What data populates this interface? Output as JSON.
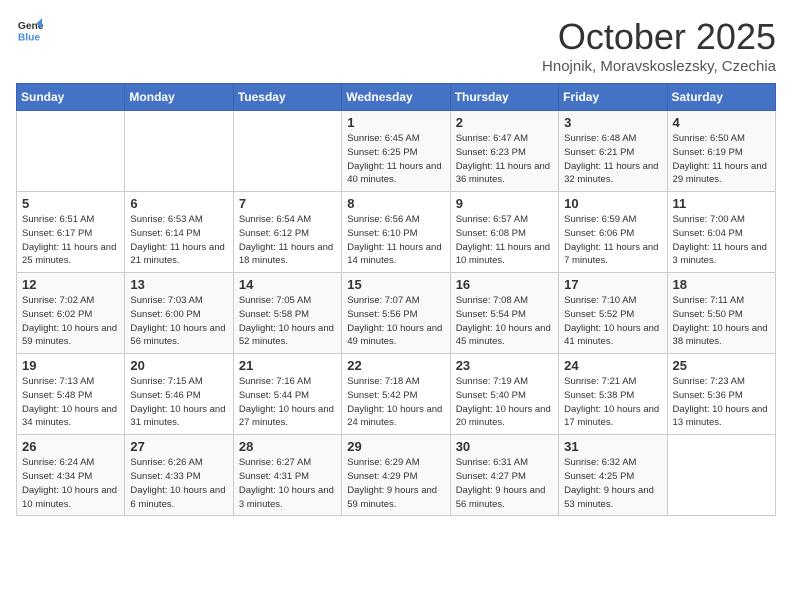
{
  "logo": {
    "line1": "General",
    "line2": "Blue"
  },
  "title": "October 2025",
  "location": "Hnojnik, Moravskoslezsky, Czechia",
  "weekdays": [
    "Sunday",
    "Monday",
    "Tuesday",
    "Wednesday",
    "Thursday",
    "Friday",
    "Saturday"
  ],
  "weeks": [
    [
      {
        "num": "",
        "info": ""
      },
      {
        "num": "",
        "info": ""
      },
      {
        "num": "",
        "info": ""
      },
      {
        "num": "1",
        "info": "Sunrise: 6:45 AM\nSunset: 6:25 PM\nDaylight: 11 hours\nand 40 minutes."
      },
      {
        "num": "2",
        "info": "Sunrise: 6:47 AM\nSunset: 6:23 PM\nDaylight: 11 hours\nand 36 minutes."
      },
      {
        "num": "3",
        "info": "Sunrise: 6:48 AM\nSunset: 6:21 PM\nDaylight: 11 hours\nand 32 minutes."
      },
      {
        "num": "4",
        "info": "Sunrise: 6:50 AM\nSunset: 6:19 PM\nDaylight: 11 hours\nand 29 minutes."
      }
    ],
    [
      {
        "num": "5",
        "info": "Sunrise: 6:51 AM\nSunset: 6:17 PM\nDaylight: 11 hours\nand 25 minutes."
      },
      {
        "num": "6",
        "info": "Sunrise: 6:53 AM\nSunset: 6:14 PM\nDaylight: 11 hours\nand 21 minutes."
      },
      {
        "num": "7",
        "info": "Sunrise: 6:54 AM\nSunset: 6:12 PM\nDaylight: 11 hours\nand 18 minutes."
      },
      {
        "num": "8",
        "info": "Sunrise: 6:56 AM\nSunset: 6:10 PM\nDaylight: 11 hours\nand 14 minutes."
      },
      {
        "num": "9",
        "info": "Sunrise: 6:57 AM\nSunset: 6:08 PM\nDaylight: 11 hours\nand 10 minutes."
      },
      {
        "num": "10",
        "info": "Sunrise: 6:59 AM\nSunset: 6:06 PM\nDaylight: 11 hours\nand 7 minutes."
      },
      {
        "num": "11",
        "info": "Sunrise: 7:00 AM\nSunset: 6:04 PM\nDaylight: 11 hours\nand 3 minutes."
      }
    ],
    [
      {
        "num": "12",
        "info": "Sunrise: 7:02 AM\nSunset: 6:02 PM\nDaylight: 10 hours\nand 59 minutes."
      },
      {
        "num": "13",
        "info": "Sunrise: 7:03 AM\nSunset: 6:00 PM\nDaylight: 10 hours\nand 56 minutes."
      },
      {
        "num": "14",
        "info": "Sunrise: 7:05 AM\nSunset: 5:58 PM\nDaylight: 10 hours\nand 52 minutes."
      },
      {
        "num": "15",
        "info": "Sunrise: 7:07 AM\nSunset: 5:56 PM\nDaylight: 10 hours\nand 49 minutes."
      },
      {
        "num": "16",
        "info": "Sunrise: 7:08 AM\nSunset: 5:54 PM\nDaylight: 10 hours\nand 45 minutes."
      },
      {
        "num": "17",
        "info": "Sunrise: 7:10 AM\nSunset: 5:52 PM\nDaylight: 10 hours\nand 41 minutes."
      },
      {
        "num": "18",
        "info": "Sunrise: 7:11 AM\nSunset: 5:50 PM\nDaylight: 10 hours\nand 38 minutes."
      }
    ],
    [
      {
        "num": "19",
        "info": "Sunrise: 7:13 AM\nSunset: 5:48 PM\nDaylight: 10 hours\nand 34 minutes."
      },
      {
        "num": "20",
        "info": "Sunrise: 7:15 AM\nSunset: 5:46 PM\nDaylight: 10 hours\nand 31 minutes."
      },
      {
        "num": "21",
        "info": "Sunrise: 7:16 AM\nSunset: 5:44 PM\nDaylight: 10 hours\nand 27 minutes."
      },
      {
        "num": "22",
        "info": "Sunrise: 7:18 AM\nSunset: 5:42 PM\nDaylight: 10 hours\nand 24 minutes."
      },
      {
        "num": "23",
        "info": "Sunrise: 7:19 AM\nSunset: 5:40 PM\nDaylight: 10 hours\nand 20 minutes."
      },
      {
        "num": "24",
        "info": "Sunrise: 7:21 AM\nSunset: 5:38 PM\nDaylight: 10 hours\nand 17 minutes."
      },
      {
        "num": "25",
        "info": "Sunrise: 7:23 AM\nSunset: 5:36 PM\nDaylight: 10 hours\nand 13 minutes."
      }
    ],
    [
      {
        "num": "26",
        "info": "Sunrise: 6:24 AM\nSunset: 4:34 PM\nDaylight: 10 hours\nand 10 minutes."
      },
      {
        "num": "27",
        "info": "Sunrise: 6:26 AM\nSunset: 4:33 PM\nDaylight: 10 hours\nand 6 minutes."
      },
      {
        "num": "28",
        "info": "Sunrise: 6:27 AM\nSunset: 4:31 PM\nDaylight: 10 hours\nand 3 minutes."
      },
      {
        "num": "29",
        "info": "Sunrise: 6:29 AM\nSunset: 4:29 PM\nDaylight: 9 hours\nand 59 minutes."
      },
      {
        "num": "30",
        "info": "Sunrise: 6:31 AM\nSunset: 4:27 PM\nDaylight: 9 hours\nand 56 minutes."
      },
      {
        "num": "31",
        "info": "Sunrise: 6:32 AM\nSunset: 4:25 PM\nDaylight: 9 hours\nand 53 minutes."
      },
      {
        "num": "",
        "info": ""
      }
    ]
  ]
}
